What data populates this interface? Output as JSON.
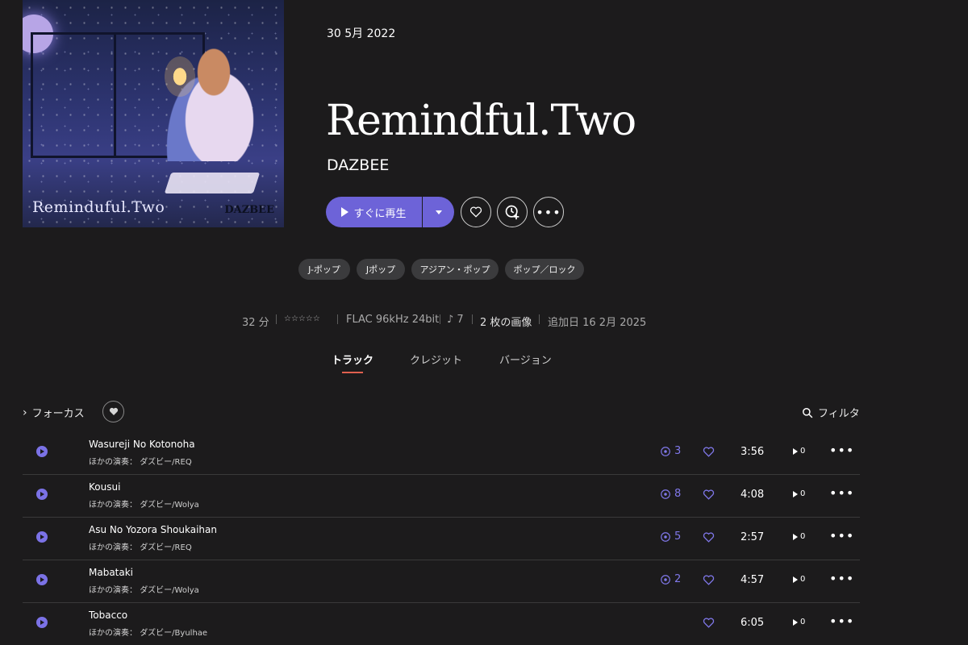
{
  "album": {
    "cover": {
      "title_text": "Reminduful.Two",
      "artist_text": "DAZBEE"
    },
    "release_date": "30 5月 2022",
    "title": "Remindful.Two",
    "artist": "DAZBEE",
    "play_label": "すぐに再生"
  },
  "genres": [
    "J-ポップ",
    "Jポップ",
    "アジアン・ポップ",
    "ポップ／ロック"
  ],
  "meta": {
    "duration": "32 分",
    "rating": "☆☆☆☆☆",
    "format": "FLAC 96kHz 24bit",
    "lyrics": "♪ 7",
    "images": "2 枚の画像",
    "added": "追加日 16 2月 2025"
  },
  "tabs": [
    {
      "label": "トラック",
      "active": true
    },
    {
      "label": "クレジット",
      "active": false
    },
    {
      "label": "バージョン",
      "active": false
    }
  ],
  "toolbar": {
    "focus_label": "フォーカス",
    "filter_label": "フィルタ"
  },
  "tracks": [
    {
      "title": "Wasureji No Kotonoha",
      "performers_label": "ほかの演奏：",
      "performers": "ダズビー/REQ",
      "versions": "3",
      "duration": "3:56",
      "plays": "0"
    },
    {
      "title": "Kousui",
      "performers_label": "ほかの演奏：",
      "performers": "ダズビー/Wolya",
      "versions": "8",
      "duration": "4:08",
      "plays": "0"
    },
    {
      "title": "Asu No Yozora Shoukaihan",
      "performers_label": "ほかの演奏：",
      "performers": "ダズビー/REQ",
      "versions": "5",
      "duration": "2:57",
      "plays": "0"
    },
    {
      "title": "Mabataki",
      "performers_label": "ほかの演奏：",
      "performers": "ダズビー/Wolya",
      "versions": "2",
      "duration": "4:57",
      "plays": "0"
    },
    {
      "title": "Tobacco",
      "performers_label": "ほかの演奏：",
      "performers": "ダズビー/Byulhae",
      "versions": "",
      "duration": "6:05",
      "plays": "0"
    }
  ],
  "colors": {
    "accent": "#6d63d8",
    "background": "#1c1b1c",
    "tab_underline": "#e0604f"
  }
}
